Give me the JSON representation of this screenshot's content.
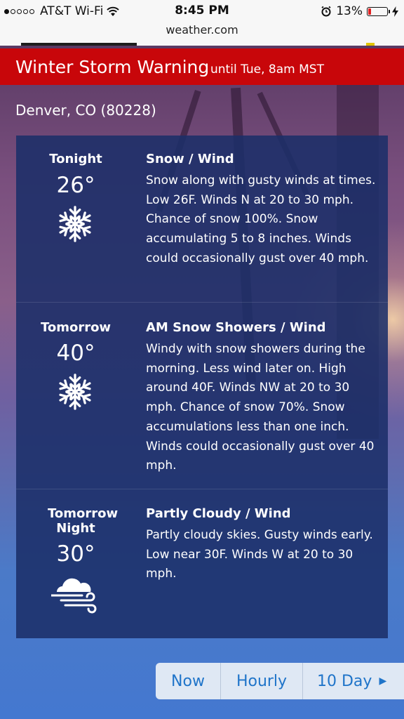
{
  "status": {
    "carrier": "AT&T Wi-Fi",
    "time": "8:45 PM",
    "battery": "13%",
    "signal_bars_filled": 1,
    "signal_bars_total": 5
  },
  "browser": {
    "url": "weather.com"
  },
  "alert": {
    "title": "Winter Storm Warning",
    "subtitle": "until Tue, 8am MST",
    "color": "#c8060a"
  },
  "location": "Denver, CO (80228)",
  "forecast": [
    {
      "name": "Tonight",
      "temp": "26°",
      "icon": "snowflake-icon",
      "condition": "Snow / Wind",
      "description": "Snow along with gusty winds at times. Low 26F. Winds N at 20 to 30 mph. Chance of snow 100%. Snow accumulating 5 to 8 inches. Winds could occasionally gust over 40 mph."
    },
    {
      "name": "Tomorrow",
      "temp": "40°",
      "icon": "snowflake-icon",
      "condition": "AM Snow Showers / Wind",
      "description": "Windy with snow showers during the morning. Less wind later on. High around 40F. Winds NW at 20 to 30 mph. Chance of snow 70%. Snow accumulations less than one inch. Winds could occasionally gust over 40 mph."
    },
    {
      "name": "Tomorrow Night",
      "temp": "30°",
      "icon": "cloud-wind-icon",
      "condition": "Partly Cloudy / Wind",
      "description": "Partly cloudy skies. Gusty winds early. Low near 30F. Winds W at 20 to 30 mph."
    }
  ],
  "tabs": [
    {
      "label": "Now"
    },
    {
      "label": "Hourly"
    },
    {
      "label": "10 Day",
      "arrow": "▶"
    }
  ]
}
